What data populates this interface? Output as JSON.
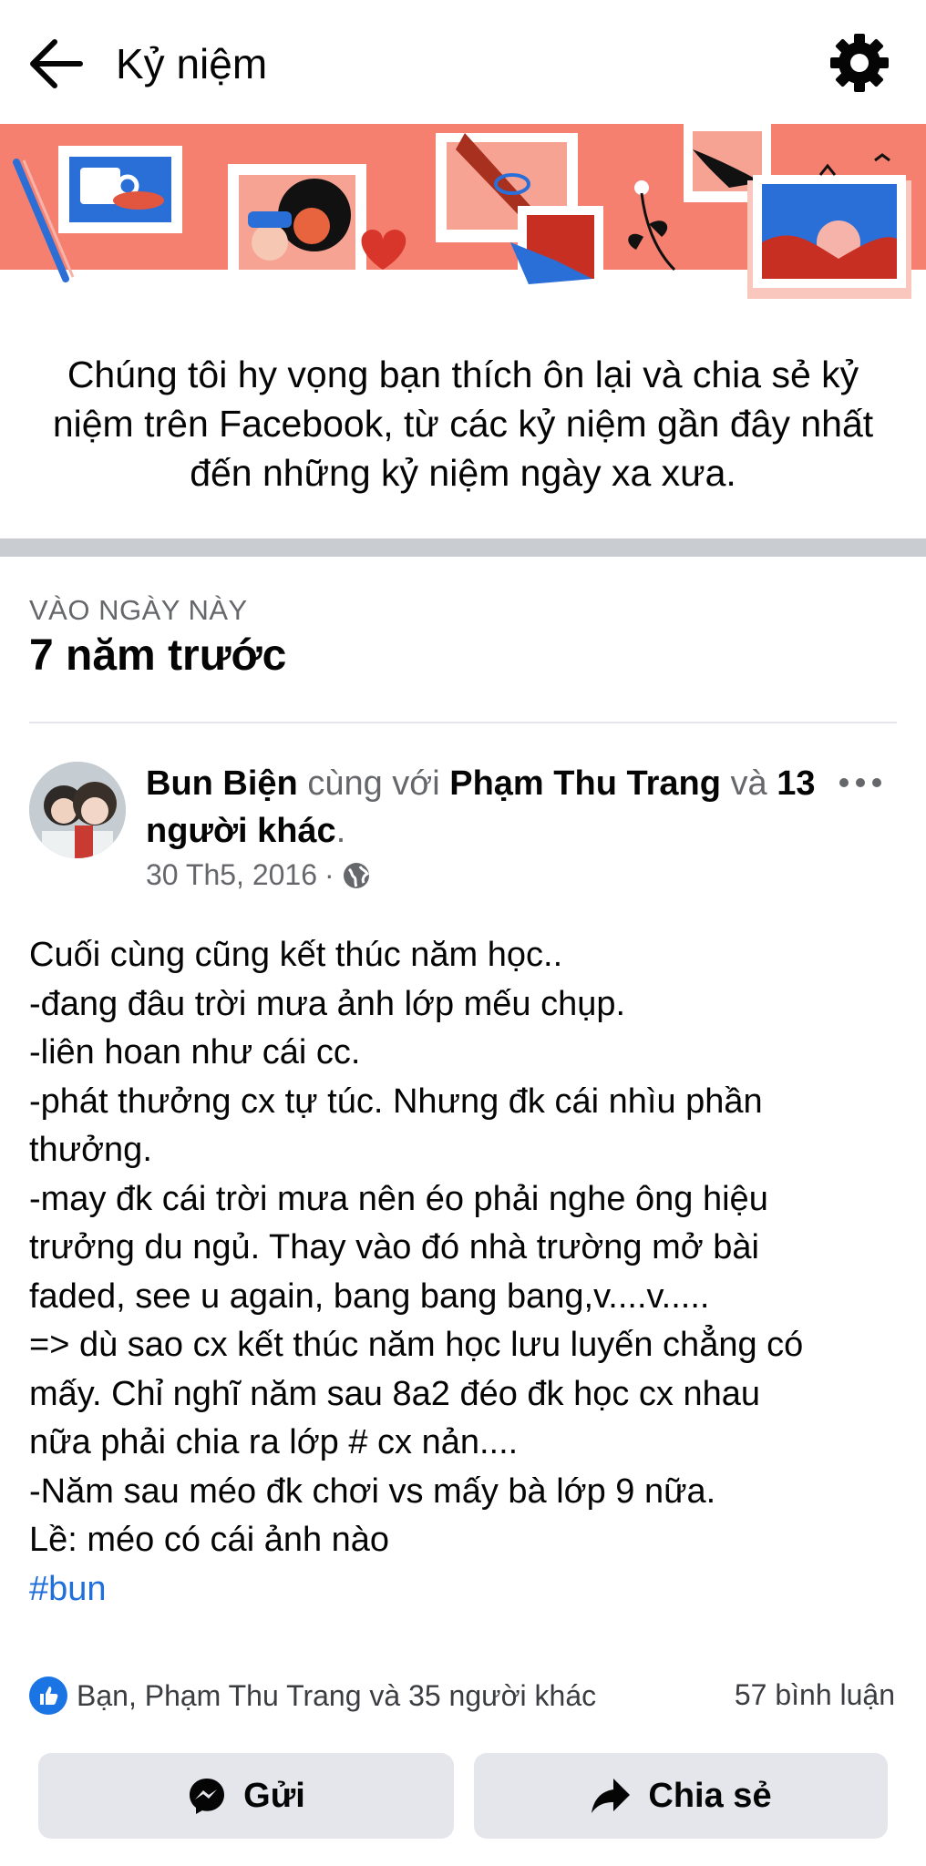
{
  "header": {
    "title": "Kỷ niệm",
    "back_icon": "arrow-left-icon",
    "settings_icon": "gear-icon"
  },
  "banner": {
    "background_color": "#f5806f",
    "illustration": "memories-illustration"
  },
  "intro": {
    "text": "Chúng tôi hy vọng bạn thích ôn lại và chia sẻ kỷ niệm trên Facebook, từ các kỷ niệm gần đây nhất đến những kỷ niệm ngày xa xưa."
  },
  "section": {
    "eyebrow": "VÀO NGÀY NÀY",
    "title": "7 năm trước"
  },
  "post": {
    "author": "Bun Biện",
    "with_text": "cùng với",
    "tagged": "Phạm Thu Trang",
    "and_text": "và",
    "others": "13 người khác",
    "period": ".",
    "date": "30 Th5, 2016",
    "dot": "·",
    "privacy_icon": "globe-icon",
    "body_lines": [
      "Cuối cùng cũng kết thúc năm học..",
      "-đang đâu trời mưa ảnh lớp mếu chụp.",
      "-liên hoan như cái cc.",
      "-phát thưởng cx tự túc. Nhưng đk cái nhìu phần",
      "thưởng.",
      "-may đk cái trời mưa nên éo phải nghe ông hiệu",
      "trưởng du ngủ. Thay vào đó nhà trường mở bài",
      "faded, see u again, bang bang bang,v....v.....",
      "=> dù sao cx kết thúc năm học lưu luyến chẳng có",
      "mấy. Chỉ nghĩ năm sau 8a2 đéo đk học cx nhau",
      "nữa phải chia ra lớp # cx nản....",
      "-Năm sau méo đk chơi vs mấy bà lớp 9 nữa.",
      "Lề: méo có cái ảnh nào"
    ],
    "hashtag": "#bun",
    "reactions_text": "Bạn, Phạm Thu Trang và 35 người khác",
    "comments_text": "57 bình luận"
  },
  "actions": {
    "send_label": "Gửi",
    "share_label": "Chia sẻ"
  },
  "colors": {
    "accent": "#1b74e4",
    "hashtag": "#216fdb",
    "muted": "#65676b",
    "button_bg": "#e4e6eb"
  }
}
